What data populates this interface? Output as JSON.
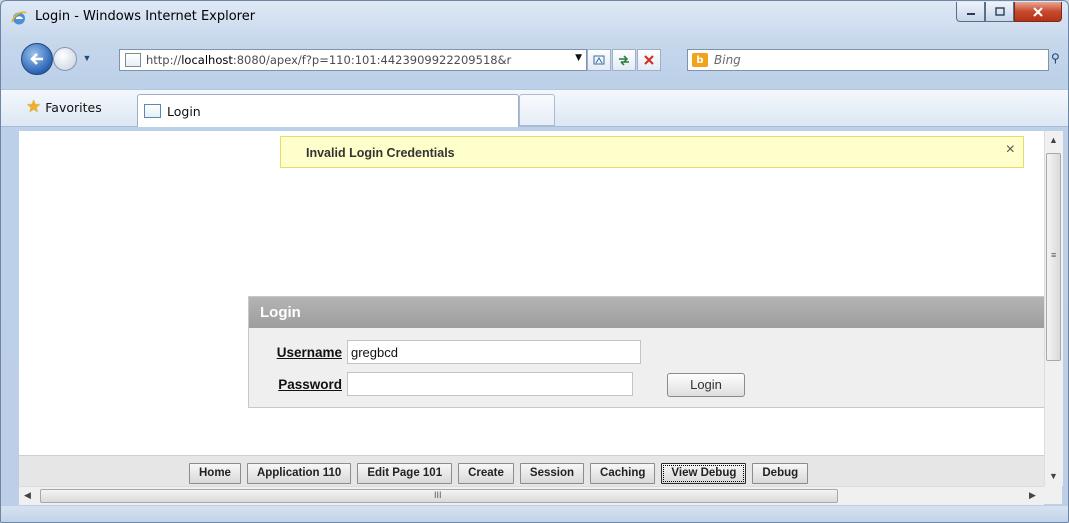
{
  "window": {
    "title": "Login - Windows Internet Explorer"
  },
  "addressbar": {
    "url_prefix": "http://",
    "url_host": "localhost",
    "url_rest": ":8080/apex/f?p=110:101:4423909922209518&r"
  },
  "search": {
    "placeholder": "Bing"
  },
  "favorites": {
    "label": "Favorites"
  },
  "tab": {
    "label": "Login"
  },
  "alert": {
    "message": "Invalid Login Credentials",
    "close_glyph": "×"
  },
  "login": {
    "header": "Login",
    "username_label": "Username",
    "username_value": "gregbcd",
    "password_label": "Password",
    "password_value": "",
    "button_label": "Login"
  },
  "devbar": {
    "buttons": [
      "Home",
      "Application 110",
      "Edit Page 101",
      "Create",
      "Session",
      "Caching",
      "View Debug",
      "Debug"
    ]
  },
  "colors": {
    "alert_bg": "#ffffcc",
    "region_header": "#a5a5a5",
    "window_frame": "#bfd2e8"
  }
}
